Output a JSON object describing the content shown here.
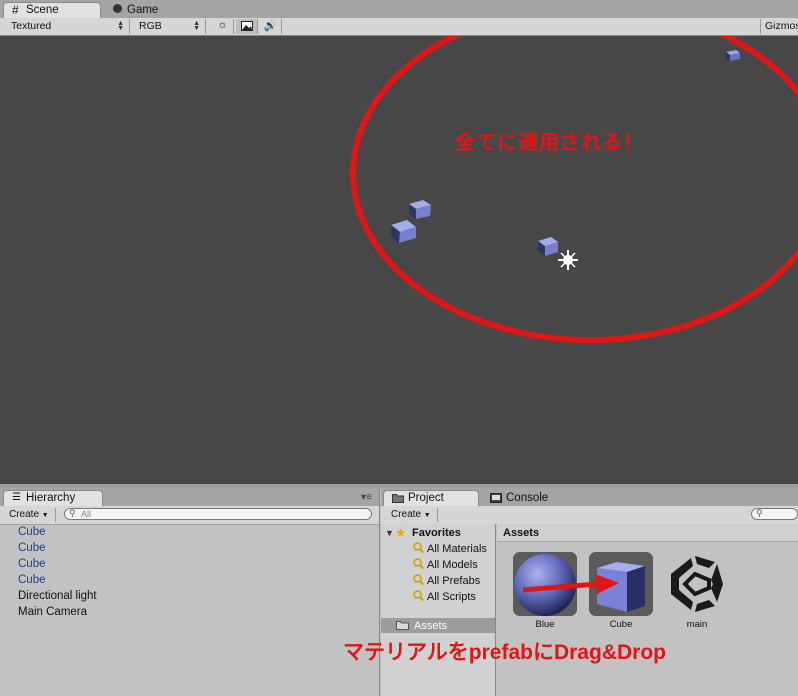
{
  "scene_tabs": [
    {
      "label": "Scene",
      "icon": "grid-icon"
    },
    {
      "label": "Game",
      "icon": "pacman-icon"
    }
  ],
  "scene_toolbar": {
    "render_mode": "Textured",
    "color_mode": "RGB",
    "gizmos_label": "Gizmos",
    "buttons": [
      "sun-icon",
      "image-icon",
      "speaker-icon"
    ]
  },
  "scene_annotation": "全てに適用される！",
  "hierarchy": {
    "tab_label": "Hierarchy",
    "create_label": "Create",
    "search_placeholder": "All",
    "items": [
      {
        "label": "Cube",
        "prefab": true
      },
      {
        "label": "Cube",
        "prefab": true
      },
      {
        "label": "Cube",
        "prefab": true
      },
      {
        "label": "Cube",
        "prefab": true
      },
      {
        "label": "Directional light",
        "prefab": false
      },
      {
        "label": "Main Camera",
        "prefab": false
      }
    ]
  },
  "project": {
    "tabs": [
      {
        "label": "Project",
        "icon": "folder-icon"
      },
      {
        "label": "Console",
        "icon": "console-icon"
      }
    ],
    "create_label": "Create",
    "sidebar": {
      "favorites_label": "Favorites",
      "favorites": [
        "All Materials",
        "All Models",
        "All Prefabs",
        "All Scripts"
      ],
      "assets_folder": "Assets"
    },
    "assets_header": "Assets",
    "assets": [
      {
        "label": "Blue",
        "icon": "material-sphere-icon"
      },
      {
        "label": "Cube",
        "icon": "prefab-cube-icon"
      },
      {
        "label": "main",
        "icon": "unity-logo-icon"
      }
    ]
  },
  "caption": "マテリアルをprefabにDrag&Drop",
  "colors": {
    "annotation_red": "#e01616",
    "scene_bg": "#474747",
    "prefab_blue": "#1d3f8a",
    "cube_blue": "#8b93d8"
  }
}
